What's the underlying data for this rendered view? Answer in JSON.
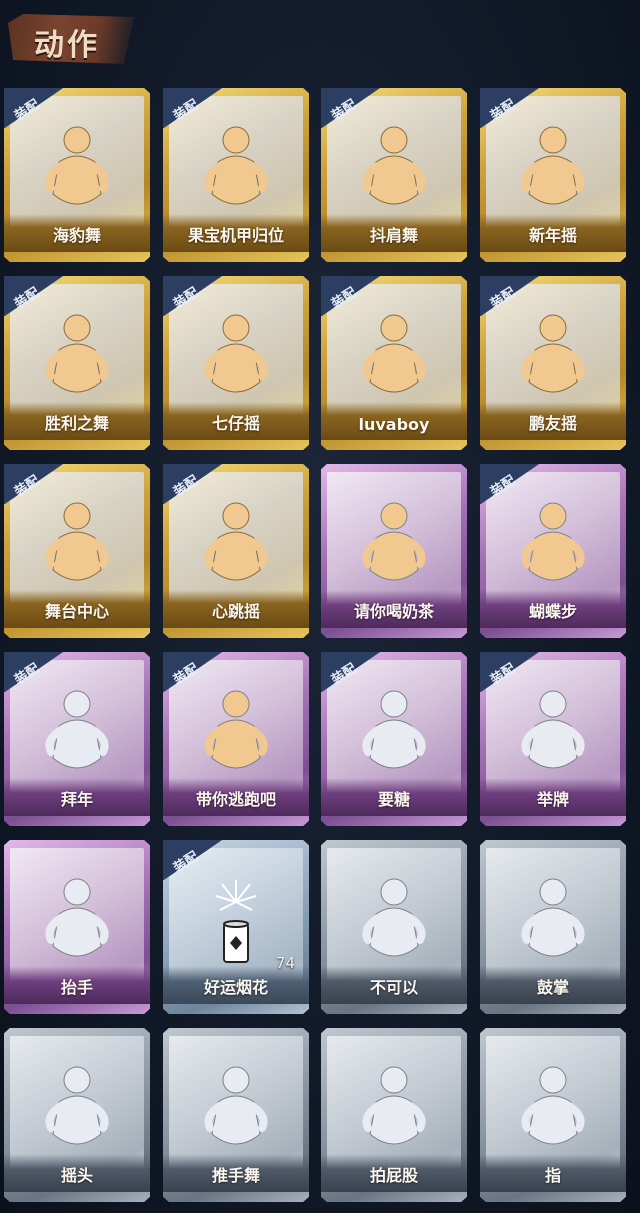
{
  "header": {
    "title": "动作"
  },
  "badge_label": "装配",
  "colors": {
    "gold": "#cfa33c",
    "purple": "#a873b8",
    "gray": "#8e99a6",
    "silverblue": "#93a8bd",
    "figure_gold": "#f0c890",
    "figure_gray": "#e8ecf2",
    "badge": "#2c3e62"
  },
  "actions": [
    {
      "name": "海豹舞",
      "rarity": "gold",
      "equipped": true,
      "icon": "seal-dance-icon"
    },
    {
      "name": "果宝机甲归位",
      "rarity": "gold",
      "equipped": true,
      "icon": "mecha-pose-icon"
    },
    {
      "name": "抖肩舞",
      "rarity": "gold",
      "equipped": true,
      "icon": "shoulder-shake-icon"
    },
    {
      "name": "新年摇",
      "rarity": "gold",
      "equipped": true,
      "icon": "new-year-sway-icon"
    },
    {
      "name": "胜利之舞",
      "rarity": "gold",
      "equipped": true,
      "icon": "victory-dance-icon"
    },
    {
      "name": "七仔摇",
      "rarity": "gold",
      "equipped": true,
      "icon": "qizai-sway-icon"
    },
    {
      "name": "luvaboy",
      "rarity": "gold",
      "equipped": true,
      "icon": "luvaboy-icon"
    },
    {
      "name": "鹏友摇",
      "rarity": "gold",
      "equipped": true,
      "icon": "pengyou-sway-icon"
    },
    {
      "name": "舞台中心",
      "rarity": "gold",
      "equipped": true,
      "icon": "stage-center-icon"
    },
    {
      "name": "心跳摇",
      "rarity": "gold",
      "equipped": true,
      "icon": "heartbeat-sway-icon"
    },
    {
      "name": "请你喝奶茶",
      "rarity": "purple",
      "equipped": false,
      "icon": "milk-tea-icon"
    },
    {
      "name": "蝴蝶步",
      "rarity": "purple",
      "equipped": true,
      "icon": "butterfly-step-icon"
    },
    {
      "name": "拜年",
      "rarity": "purple",
      "equipped": true,
      "icon": "new-year-greeting-icon"
    },
    {
      "name": "带你逃跑吧",
      "rarity": "purple",
      "equipped": true,
      "icon": "run-away-icon"
    },
    {
      "name": "要糖",
      "rarity": "purple",
      "equipped": true,
      "icon": "ask-candy-icon"
    },
    {
      "name": "举牌",
      "rarity": "purple",
      "equipped": true,
      "icon": "hold-sign-icon"
    },
    {
      "name": "抬手",
      "rarity": "purple",
      "equipped": false,
      "icon": "raise-hand-icon"
    },
    {
      "name": "好运烟花",
      "rarity": "silverblue",
      "equipped": true,
      "icon": "firework-icon",
      "count": "74"
    },
    {
      "name": "不可以",
      "rarity": "gray",
      "equipped": false,
      "icon": "finger-wag-icon"
    },
    {
      "name": "鼓掌",
      "rarity": "gray",
      "equipped": false,
      "icon": "clap-icon"
    },
    {
      "name": "摇头",
      "rarity": "gray",
      "equipped": false,
      "icon": "head-shake-icon"
    },
    {
      "name": "推手舞",
      "rarity": "gray",
      "equipped": false,
      "icon": "push-hand-dance-icon"
    },
    {
      "name": "拍屁股",
      "rarity": "gray",
      "equipped": false,
      "icon": "butt-slap-icon"
    },
    {
      "name": "指",
      "rarity": "gray",
      "equipped": false,
      "icon": "point-icon"
    }
  ]
}
